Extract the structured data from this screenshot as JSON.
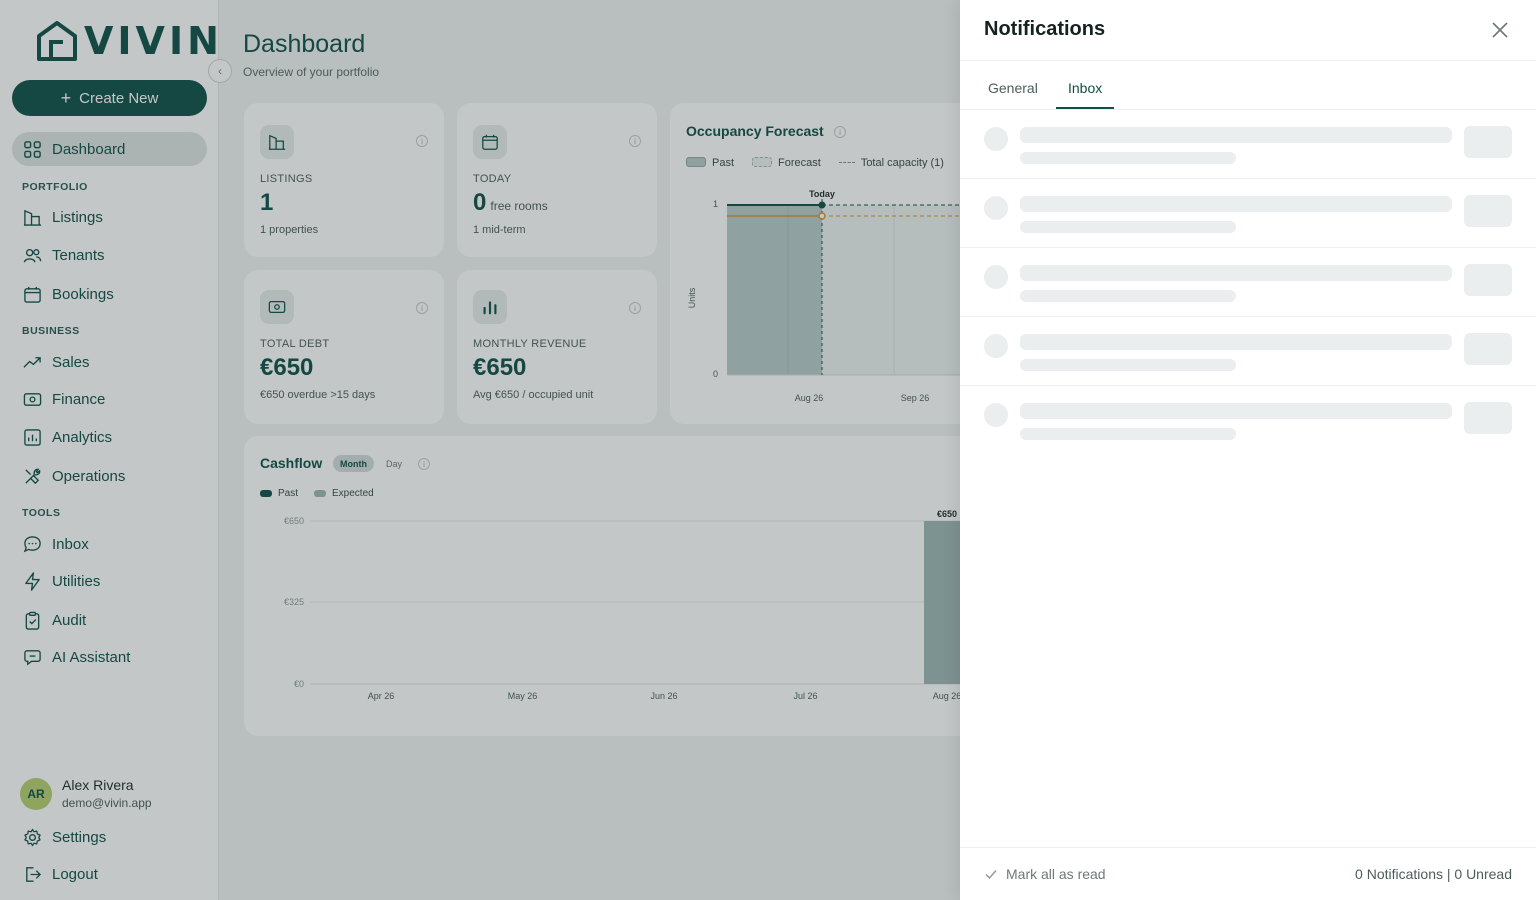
{
  "brand": {
    "logo_text": "VIVIN"
  },
  "sidebar": {
    "create_label": "Create New",
    "items": [
      {
        "label": "Dashboard"
      },
      {
        "label": "Listings"
      },
      {
        "label": "Tenants"
      },
      {
        "label": "Bookings"
      },
      {
        "label": "Sales"
      },
      {
        "label": "Finance"
      },
      {
        "label": "Analytics"
      },
      {
        "label": "Operations"
      },
      {
        "label": "Inbox"
      },
      {
        "label": "Utilities"
      },
      {
        "label": "Audit"
      },
      {
        "label": "AI Assistant"
      }
    ],
    "sections": {
      "portfolio": "PORTFOLIO",
      "business": "BUSINESS",
      "tools": "TOOLS"
    },
    "user": {
      "initials": "AR",
      "name": "Alex Rivera",
      "email": "demo@vivin.app"
    },
    "settings_label": "Settings",
    "logout_label": "Logout"
  },
  "header": {
    "title": "Dashboard",
    "subtitle": "Overview of your portfolio"
  },
  "stats": {
    "listings": {
      "label": "LISTINGS",
      "value": "1",
      "sub": "1 properties"
    },
    "today": {
      "label": "TODAY",
      "value": "0",
      "value_suffix": "free rooms",
      "sub": "1 mid-term"
    },
    "debt": {
      "label": "TOTAL DEBT",
      "value": "€650",
      "sub": "€650 overdue >15 days"
    },
    "revenue": {
      "label": "MONTHLY REVENUE",
      "value": "€650",
      "sub": "Avg €650 / occupied unit"
    }
  },
  "occupancy": {
    "title": "Occupancy Forecast",
    "legend": {
      "past": "Past",
      "forecast": "Forecast",
      "capacity": "Total capacity (1)"
    },
    "today_label": "Today",
    "y_axis_label": "Units",
    "y_ticks": [
      "1",
      "0"
    ],
    "x_ticks": [
      "Aug 26",
      "Sep 26"
    ]
  },
  "cashflow": {
    "title": "Cashflow",
    "toggle": {
      "month": "Month",
      "day": "Day"
    },
    "legend": {
      "past": "Past",
      "expected": "Expected"
    },
    "y_ticks": [
      "€650",
      "€325",
      "€0"
    ],
    "bar_label": "€650"
  },
  "chart_data": [
    {
      "type": "area",
      "title": "Occupancy Forecast",
      "ylabel": "Units",
      "x": [
        "Aug 26",
        "Sep 26"
      ],
      "ylim": [
        0,
        1
      ],
      "series": [
        {
          "name": "Past",
          "values": [
            1,
            1
          ]
        },
        {
          "name": "Total capacity (1)",
          "values": [
            1,
            1
          ]
        }
      ]
    },
    {
      "type": "bar",
      "title": "Cashflow",
      "categories": [
        "Apr 26",
        "May 26",
        "Jun 26",
        "Jul 26",
        "Aug 26"
      ],
      "series": [
        {
          "name": "Expected",
          "values": [
            0,
            0,
            0,
            0,
            650
          ]
        }
      ],
      "ylim": [
        0,
        650
      ]
    }
  ],
  "notifications": {
    "title": "Notifications",
    "tabs": [
      {
        "label": "General"
      },
      {
        "label": "Inbox"
      }
    ],
    "mark_all_label": "Mark all as read",
    "count_text": "0 Notifications | 0 Unread"
  },
  "colors": {
    "brand": "#0f4f48",
    "past": "#9fb8b5",
    "capacity": "#d9952b",
    "avatar": "#b8cf6e"
  }
}
